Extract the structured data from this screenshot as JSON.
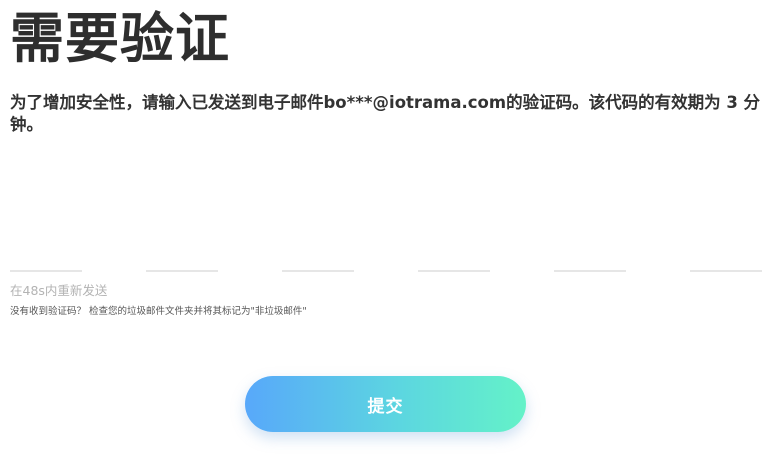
{
  "page": {
    "title": "需要验证",
    "description": "为了增加安全性，请输入已发送到电子邮件bo***@iotrama.com的验证码。该代码的有效期为 3 分钟。"
  },
  "code": {
    "length": 6,
    "values": [
      "",
      "",
      "",
      "",
      "",
      ""
    ]
  },
  "resend": {
    "label": "在48s内重新发送"
  },
  "hint": {
    "text": "没有收到验证码？ 检查您的垃圾邮件文件夹并将其标记为\"非垃圾邮件\""
  },
  "submit": {
    "label": "提交"
  }
}
